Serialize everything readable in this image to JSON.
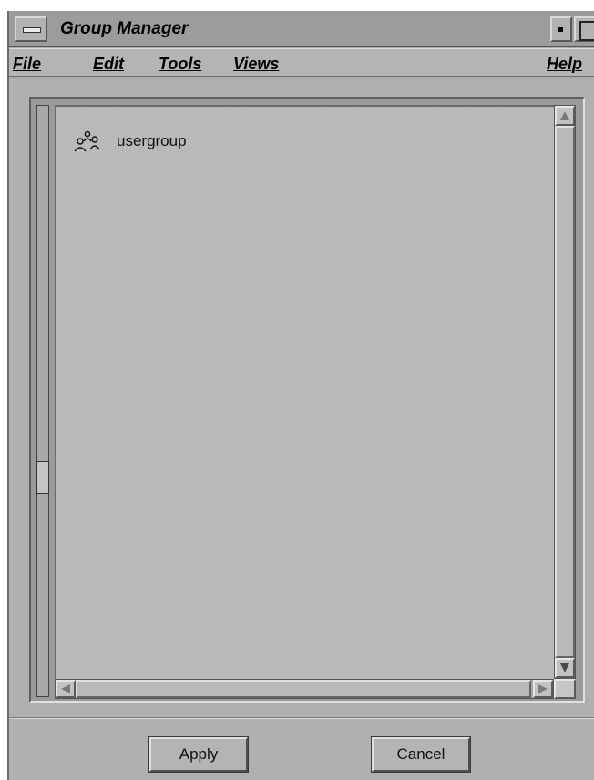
{
  "window": {
    "title": "Group Manager"
  },
  "menu": {
    "file": "File",
    "edit": "Edit",
    "tools": "Tools",
    "views": "Views",
    "help": "Help"
  },
  "list": {
    "items": [
      {
        "label": "usergroup",
        "icon": "group-icon"
      }
    ]
  },
  "buttons": {
    "apply": "Apply",
    "cancel": "Cancel"
  }
}
